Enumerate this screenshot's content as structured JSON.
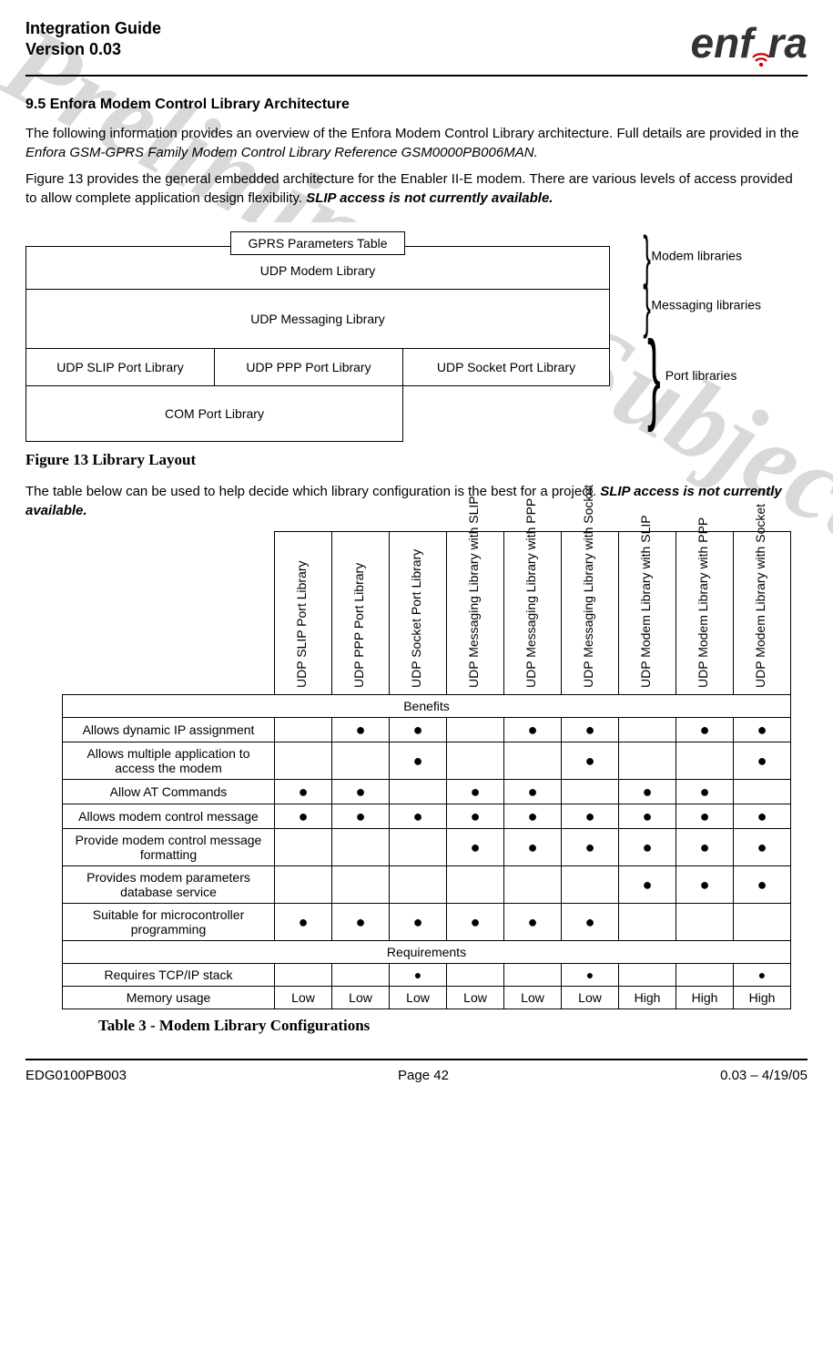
{
  "header": {
    "title_line1": "Integration Guide",
    "title_line2": "Version 0.03",
    "logo_text_pre": "enf",
    "logo_text_post": "ra"
  },
  "watermark": "Preliminary - Subject to change",
  "section": {
    "number": "9.5",
    "title": "Enfora Modem Control Library Architecture"
  },
  "para1_a": "The following information provides an overview of the Enfora Modem Control Library architecture.  Full details are provided in the ",
  "para1_b": "Enfora GSM-GPRS Family Modem Control Library Reference GSM0000PB006MAN.",
  "para2_a": "Figure 13 provides the general embedded architecture for the Enabler II-E modem.  There are various levels of access provided to allow complete application design flexibility.  ",
  "para2_b": "SLIP access is not currently available.",
  "diagram": {
    "gprs": "GPRS Parameters Table",
    "udp_modem": "UDP Modem Library",
    "udp_msg": "UDP Messaging Library",
    "slip": "UDP SLIP Port Library",
    "ppp": "UDP PPP Port Library",
    "socket": "UDP Socket Port Library",
    "com": "COM Port Library",
    "annot1": "Modem libraries",
    "annot2": "Messaging libraries",
    "annot3": "Port libraries"
  },
  "fig_caption": "Figure 13 Library Layout",
  "para3_a": "The table below can be used to help decide which library configuration is the best for a project.  ",
  "para3_b": "SLIP access is not currently available.",
  "lib_table": {
    "columns": [
      "UDP SLIP Port Library",
      "UDP PPP Port Library",
      "UDP Socket Port Library",
      "UDP Messaging Library with SLIP",
      "UDP Messaging Library with PPP",
      "UDP Messaging Library with Socket",
      "UDP Modem Library with SLIP",
      "UDP Modem Library with PPP",
      "UDP Modem Library with Socket"
    ],
    "section_benefits": "Benefits",
    "rows_benefits": [
      {
        "label": "Allows dynamic IP assignment",
        "cells": [
          "",
          "●",
          "●",
          "",
          "●",
          "●",
          "",
          "●",
          "●"
        ]
      },
      {
        "label": "Allows multiple application to access the modem",
        "cells": [
          "",
          "",
          "●",
          "",
          "",
          "●",
          "",
          "",
          "●"
        ]
      },
      {
        "label": "Allow AT Commands",
        "cells": [
          "●",
          "●",
          "",
          "●",
          "●",
          "",
          "●",
          "●",
          ""
        ]
      },
      {
        "label": "Allows modem control message",
        "cells": [
          "●",
          "●",
          "●",
          "●",
          "●",
          "●",
          "●",
          "●",
          "●"
        ]
      },
      {
        "label": "Provide modem control message formatting",
        "cells": [
          "",
          "",
          "",
          "●",
          "●",
          "●",
          "●",
          "●",
          "●"
        ]
      },
      {
        "label": "Provides modem parameters database service",
        "cells": [
          "",
          "",
          "",
          "",
          "",
          "",
          "●",
          "●",
          "●"
        ]
      },
      {
        "label": "Suitable for microcontroller programming",
        "cells": [
          "●",
          "●",
          "●",
          "●",
          "●",
          "●",
          "",
          "",
          ""
        ]
      }
    ],
    "section_requirements": "Requirements",
    "rows_requirements": [
      {
        "label": "Requires TCP/IP stack",
        "cells": [
          "",
          "",
          "●",
          "",
          "",
          "●",
          "",
          "",
          "●"
        ]
      },
      {
        "label": "Memory usage",
        "cells": [
          "Low",
          "Low",
          "Low",
          "Low",
          "Low",
          "Low",
          "High",
          "High",
          "High"
        ]
      }
    ]
  },
  "tbl_caption": "Table 3 - Modem Library Configurations",
  "footer": {
    "left": "EDG0100PB003",
    "center": "Page 42",
    "right": "0.03 – 4/19/05"
  }
}
